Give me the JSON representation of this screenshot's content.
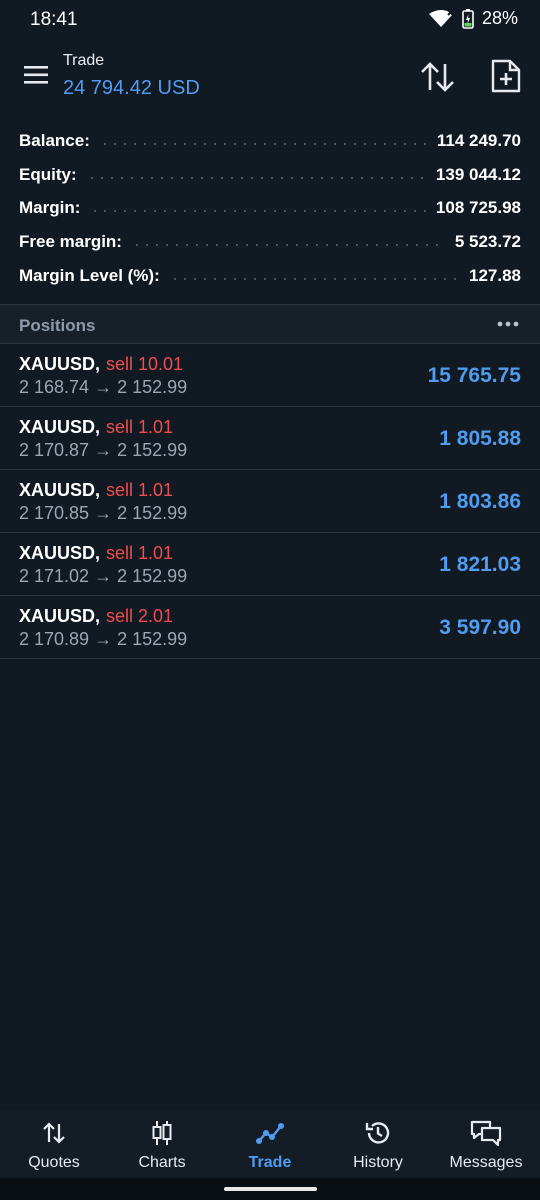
{
  "status_bar": {
    "time": "18:41",
    "battery": "28%"
  },
  "header": {
    "title": "Trade",
    "subtitle": "24 794.42 USD"
  },
  "account_summary": [
    {
      "label": "Balance:",
      "value": "114 249.70"
    },
    {
      "label": "Equity:",
      "value": "139 044.12"
    },
    {
      "label": "Margin:",
      "value": "108 725.98"
    },
    {
      "label": "Free margin:",
      "value": "5 523.72"
    },
    {
      "label": "Margin Level (%):",
      "value": "127.88"
    }
  ],
  "positions": {
    "title": "Positions",
    "items": [
      {
        "symbol": "XAUUSD,",
        "side": "sell 10.01",
        "prices": "2 168.74 → 2 152.99",
        "profit": "15 765.75"
      },
      {
        "symbol": "XAUUSD,",
        "side": "sell 1.01",
        "prices": "2 170.87 → 2 152.99",
        "profit": "1 805.88"
      },
      {
        "symbol": "XAUUSD,",
        "side": "sell 1.01",
        "prices": "2 170.85 → 2 152.99",
        "profit": "1 803.86"
      },
      {
        "symbol": "XAUUSD,",
        "side": "sell 1.01",
        "prices": "2 171.02 → 2 152.99",
        "profit": "1 821.03"
      },
      {
        "symbol": "XAUUSD,",
        "side": "sell 2.01",
        "prices": "2 170.89 → 2 152.99",
        "profit": "3 597.90"
      }
    ]
  },
  "bottom_nav": [
    {
      "label": "Quotes",
      "icon": "quotes-icon"
    },
    {
      "label": "Charts",
      "icon": "candlestick-icon"
    },
    {
      "label": "Trade",
      "icon": "trade-icon",
      "active": true
    },
    {
      "label": "History",
      "icon": "history-icon"
    },
    {
      "label": "Messages",
      "icon": "messages-icon"
    }
  ],
  "colors": {
    "background": "#111922",
    "accent": "#4f9cf0",
    "sell": "#ef4d4d"
  }
}
